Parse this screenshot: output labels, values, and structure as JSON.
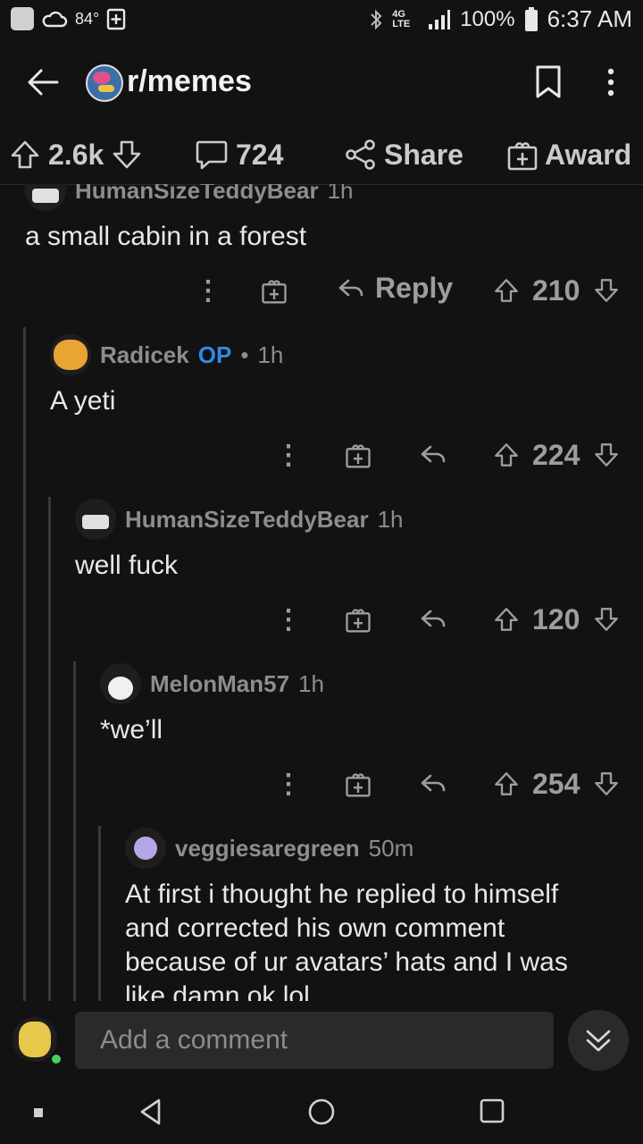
{
  "status_bar": {
    "temperature": "84°",
    "network": "4G LTE",
    "battery": "100%",
    "time": "6:37 AM",
    "icons": [
      "app-icon",
      "cloud-icon",
      "add-box-icon",
      "bluetooth-icon",
      "signal-icon",
      "battery-icon"
    ]
  },
  "header": {
    "subreddit": "r/memes",
    "icons": [
      "back-arrow-icon",
      "subreddit-avatar",
      "bookmark-icon",
      "more-vertical-icon"
    ]
  },
  "post_actions": {
    "votes": "2.6k",
    "comments": "724",
    "share_label": "Share",
    "award_label": "Award"
  },
  "comments": [
    {
      "author": "HumanSizeTeddyBear",
      "time": "1h",
      "body": "a small cabin in a forest",
      "reply_label": "Reply",
      "score": "210"
    },
    {
      "author": "Radicek",
      "op_label": "OP",
      "sep": "•",
      "time": "1h",
      "body": "A yeti",
      "score": "224"
    },
    {
      "author": "HumanSizeTeddyBear",
      "time": "1h",
      "body": "well fuck",
      "score": "120"
    },
    {
      "author": "MelonMan57",
      "time": "1h",
      "body": "*we’ll",
      "score": "254"
    },
    {
      "author": "veggiesaregreen",
      "time": "50m",
      "body_lines": [
        "At first i thought he replied to himself",
        "and corrected his own comment",
        "because of ur avatars’ hats and I was",
        "like damn ok lol"
      ]
    }
  ],
  "composer": {
    "placeholder": "Add a comment"
  },
  "colors": {
    "background": "#121212",
    "accent_op": "#2f8be6",
    "thread_line": "#3a3a3a",
    "online_dot": "#46d160"
  }
}
